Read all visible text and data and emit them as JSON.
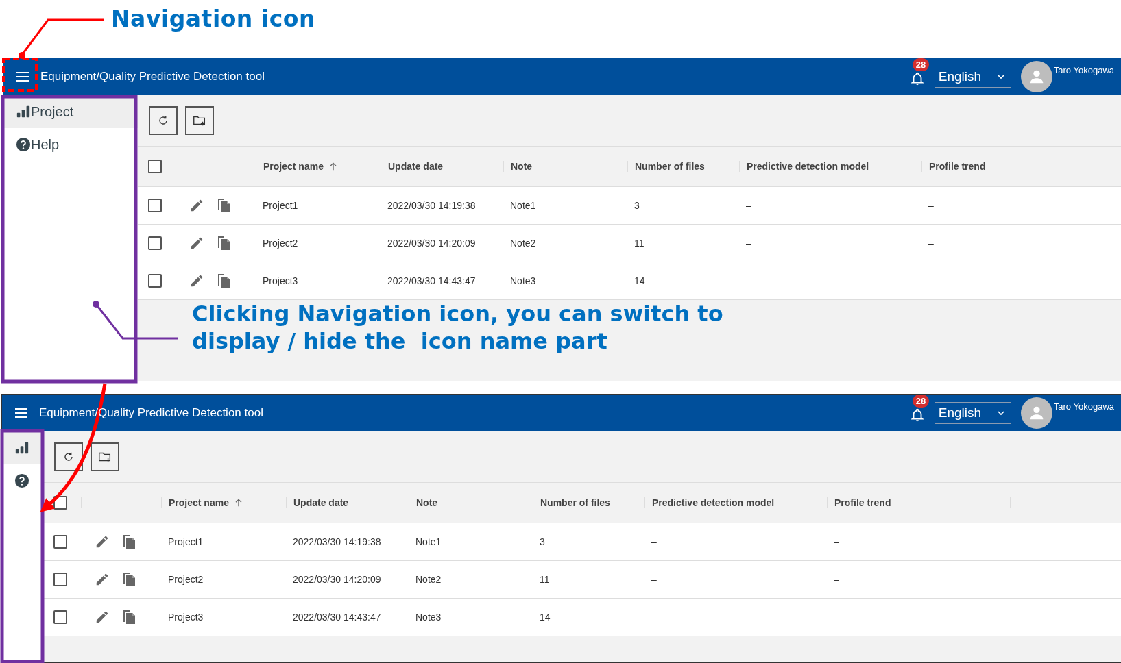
{
  "annotations": {
    "title": "Navigation icon",
    "note_lines": [
      "Clicking Navigation icon, you can switch to",
      "display / hide the  icon name part"
    ]
  },
  "screens": [
    {
      "sidebar_expanded": true,
      "app_title": "Equipment/Quality Predictive Detection tool",
      "notification_count": "28",
      "language": "English",
      "user_name": "Taro Yokogawa",
      "nav_items": [
        {
          "kind": "project",
          "label": "Project",
          "selected": true
        },
        {
          "kind": "help",
          "label": "Help",
          "selected": false
        }
      ],
      "table": {
        "header_checked": false,
        "columns": [
          {
            "label": "Project name",
            "sorted_ascending": true
          },
          {
            "label": "Update date",
            "sorted_ascending": false
          },
          {
            "label": "Note",
            "sorted_ascending": false
          },
          {
            "label": "Number of files",
            "sorted_ascending": false
          },
          {
            "label": "Predictive detection model",
            "sorted_ascending": false
          },
          {
            "label": "Profile trend",
            "sorted_ascending": false
          }
        ],
        "rows": [
          {
            "checked": false,
            "cells": [
              "Project1",
              "2022/03/30 14:19:38",
              "Note1",
              "3",
              "–",
              "–"
            ]
          },
          {
            "checked": false,
            "cells": [
              "Project2",
              "2022/03/30 14:20:09",
              "Note2",
              "11",
              "–",
              "–"
            ]
          },
          {
            "checked": false,
            "cells": [
              "Project3",
              "2022/03/30 14:43:47",
              "Note3",
              "14",
              "–",
              "–"
            ]
          }
        ]
      }
    },
    {
      "sidebar_expanded": false,
      "app_title": "Equipment/Quality Predictive Detection tool",
      "notification_count": "28",
      "language": "English",
      "user_name": "Taro Yokogawa",
      "nav_items": [
        {
          "kind": "project",
          "selected": true
        },
        {
          "kind": "help",
          "selected": false
        }
      ],
      "table": {
        "header_checked": false,
        "columns": [
          {
            "label": "Project name",
            "sorted_ascending": true
          },
          {
            "label": "Update date",
            "sorted_ascending": false
          },
          {
            "label": "Note",
            "sorted_ascending": false
          },
          {
            "label": "Number of files",
            "sorted_ascending": false
          },
          {
            "label": "Predictive detection model",
            "sorted_ascending": false
          },
          {
            "label": "Profile trend",
            "sorted_ascending": false
          }
        ],
        "rows": [
          {
            "checked": false,
            "cells": [
              "Project1",
              "2022/03/30 14:19:38",
              "Note1",
              "3",
              "–",
              "–"
            ]
          },
          {
            "checked": false,
            "cells": [
              "Project2",
              "2022/03/30 14:20:09",
              "Note2",
              "11",
              "–",
              "–"
            ]
          },
          {
            "checked": false,
            "cells": [
              "Project3",
              "2022/03/30 14:43:47",
              "Note3",
              "14",
              "–",
              "–"
            ]
          }
        ]
      }
    }
  ]
}
